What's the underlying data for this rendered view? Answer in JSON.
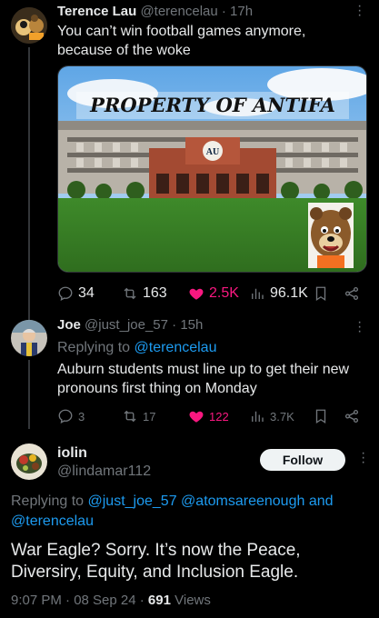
{
  "tweet1": {
    "name": "Terence Lau",
    "handle": "@terencelau",
    "time": "· 17h",
    "text_line1": "You can’t win football games anymore,",
    "text_line2": "because of the woke",
    "image_caption": "PROPERTY OF ANTIFA",
    "stats": {
      "replies": "34",
      "retweets": "163",
      "likes": "2.5K",
      "views": "96.1K"
    }
  },
  "tweet2": {
    "name": "Joe",
    "handle": "@just_joe_57",
    "time": "· 15h",
    "replying_prefix": "Replying to",
    "replying_to": "@terencelau",
    "text_line1": "Auburn students must line up to get their new",
    "text_line2": "pronouns first thing on Monday",
    "stats": {
      "replies": "3",
      "retweets": "17",
      "likes": "122",
      "views": "3.7K"
    }
  },
  "main": {
    "name": "iolin",
    "handle": "@lindamar112",
    "follow_label": "Follow",
    "replying_prefix": "Replying to",
    "replying_to_1": "@just_joe_57",
    "replying_to_2": "@atomsareenough",
    "replying_and": "and",
    "replying_to_3": "@terencelau",
    "text_line1": "War Eagle? Sorry. It’s now the Peace,",
    "text_line2": "Diversiry, Equity, and Inclusion Eagle.",
    "timestamp": "9:07 PM · 08 Sep 24 · ",
    "views_count": "691",
    "views_label": "Views"
  },
  "colors": {
    "like_active": "#f91880",
    "link": "#1d9bf0",
    "muted": "#71767b"
  }
}
